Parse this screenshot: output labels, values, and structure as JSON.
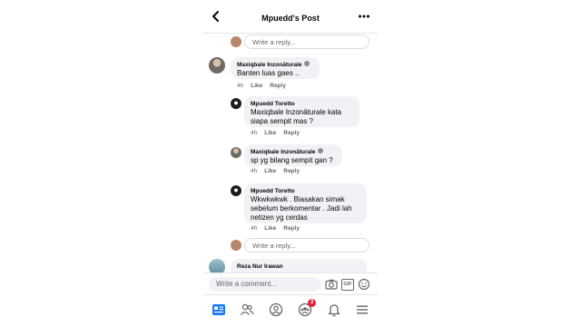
{
  "header": {
    "title": "Mpuedd's Post",
    "back_icon": "arrow-left-icon",
    "more_icon": "more-horizontal-icon"
  },
  "reply_placeholder": "Write a reply...",
  "comments": [
    {
      "author": "Maxiqbale Inzonāturale",
      "text": "Banten luas gaes ..",
      "time": "4h",
      "like": "Like",
      "reply": "Reply"
    },
    {
      "author": "Mpuedd Toretto",
      "text_lines": [
        "Maxiqbale Inzonāturale kata",
        "siapa sempit mas ?"
      ],
      "time": "4h",
      "like": "Like",
      "reply": "Reply"
    },
    {
      "author": "Maxiqbale Inzonāturale",
      "text": "sp yg bilang sempit gan ?",
      "time": "4h",
      "like": "Like",
      "reply": "Reply"
    },
    {
      "author": "Mpuedd Toretto",
      "text_lines": [
        "Wkwkwkwk . Biasakan simak",
        "sebelum berkomentar . Jadi lah",
        "netizen yg cerdas"
      ],
      "time": "4h",
      "like": "Like",
      "reply": "Reply"
    },
    {
      "author": "Reza Nur Irawan"
    }
  ],
  "composer": {
    "placeholder": "Write a comment...",
    "gif_label": "GIF"
  },
  "nav": {
    "badge_count": "3"
  },
  "colors": {
    "accent": "#1877f2",
    "bubble": "#f0f2f5",
    "meta": "#65676b",
    "badge": "#e41e3f"
  }
}
